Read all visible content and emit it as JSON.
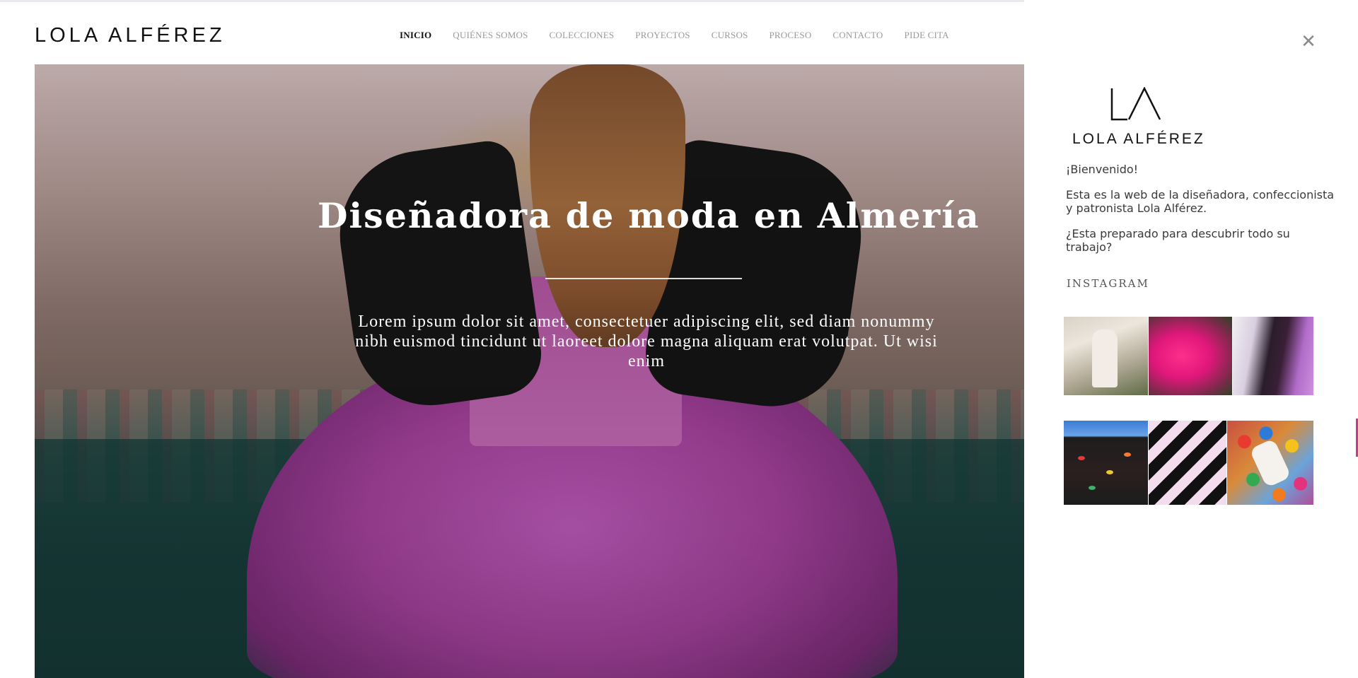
{
  "header": {
    "brand": "LOLA ALFÉREZ",
    "nav": [
      {
        "label": "INICIO",
        "active": true
      },
      {
        "label": "QUIÉNES SOMOS",
        "active": false
      },
      {
        "label": "COLECCIONES",
        "active": false
      },
      {
        "label": "PROYECTOS",
        "active": false
      },
      {
        "label": "CURSOS",
        "active": false
      },
      {
        "label": "PROCESO",
        "active": false
      },
      {
        "label": "CONTACTO",
        "active": false
      },
      {
        "label": "PIDE CITA",
        "active": false
      }
    ]
  },
  "hero": {
    "title": "Diseñadora de moda en Almería",
    "subtitle": "Lorem ipsum dolor sit amet, consectetuer adipiscing elit, sed diam nonummy nibh euismod tincidunt ut laoreet dolore magna aliquam erat volutpat. Ut wisi enim"
  },
  "panel": {
    "close_icon": "close-icon",
    "logo_mark": "LA",
    "logo_text": "LOLA ALFÉREZ",
    "welcome": "¡Bienvenido!",
    "intro": "Esta es la web de la diseñadora, confeccionista y patronista Lola Alférez.",
    "question": "¿Esta preparado para descubrir todo su trabajo?",
    "instagram_label": "INSTAGRAM"
  },
  "colors": {
    "text_dark": "#111111",
    "nav_inactive": "#9a9a9a",
    "dress_accent": "#b54fa9"
  }
}
